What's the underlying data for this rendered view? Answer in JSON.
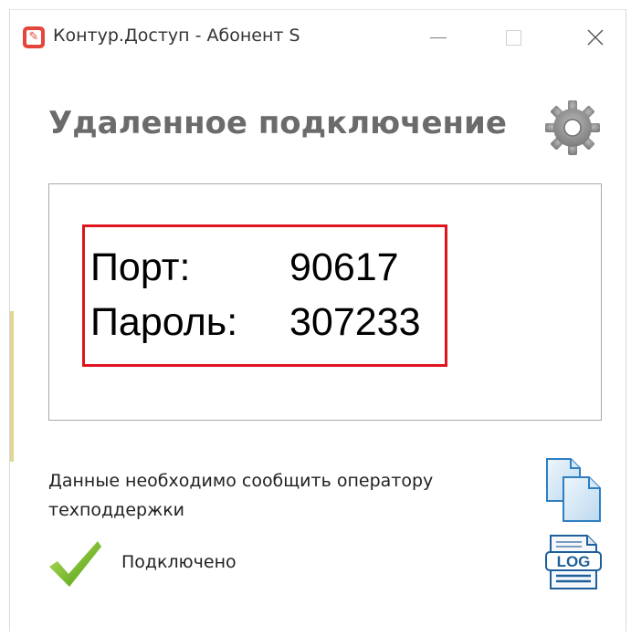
{
  "window": {
    "title": "Контур.Доступ - Абонент S",
    "app_icon": "kontur-app-icon",
    "minimize_icon": "minimize-icon",
    "maximize_icon": "maximize-icon",
    "close_icon": "close-icon",
    "close_glyph": "✕"
  },
  "header": {
    "title": "Удаленное подключение",
    "settings_icon": "gear-icon"
  },
  "credentials": {
    "port_label": "Порт:",
    "port_value": "90617",
    "password_label": "Пароль:",
    "password_value": "307233",
    "highlight_color": "#e0141e"
  },
  "footer": {
    "note": "Данные необходимо сообщить оператору техподдержки",
    "copy_icon": "copy-icon",
    "status_icon": "checkmark-icon",
    "status_text": "Подключено",
    "log_icon": "log-file-icon",
    "log_badge": "LOG"
  },
  "colors": {
    "heading": "#6b6b6b",
    "status_check": "#6abf1e",
    "app_icon": "#e5453a"
  }
}
